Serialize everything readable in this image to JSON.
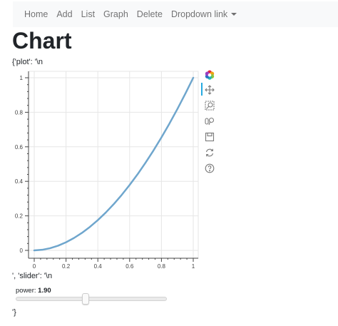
{
  "nav": {
    "items": [
      "Home",
      "Add",
      "List",
      "Graph",
      "Delete"
    ],
    "dropdown_label": "Dropdown link"
  },
  "page": {
    "title": "Chart",
    "prefix_text": "{'plot': '\\n",
    "middle_text": "', 'slider': '\\n",
    "suffix_text": "'}"
  },
  "slider": {
    "label": "power: ",
    "value_text": "1.90",
    "value": 1.9,
    "start": 0.1,
    "end": 4
  },
  "toolbar": {
    "tools": [
      "bokeh-logo-icon",
      "pan-icon",
      "box-zoom-icon",
      "wheel-zoom-icon",
      "save-icon",
      "reset-icon",
      "help-icon"
    ]
  },
  "chart_data": {
    "type": "line",
    "function": "y = x^power",
    "power": 1.9,
    "xlim": [
      0,
      1
    ],
    "ylim": [
      0,
      1
    ],
    "xticks": [
      "0",
      "0.2",
      "0.4",
      "0.6",
      "0.8",
      "1"
    ],
    "yticks": [
      "0",
      "0.2",
      "0.4",
      "0.6",
      "0.8",
      "1"
    ],
    "x": [
      0,
      0.05,
      0.1,
      0.15,
      0.2,
      0.25,
      0.3,
      0.35,
      0.4,
      0.45,
      0.5,
      0.55,
      0.6,
      0.65,
      0.7,
      0.75,
      0.8,
      0.85,
      0.9,
      0.95,
      1
    ],
    "y": [
      0,
      0.0034,
      0.0126,
      0.0272,
      0.047,
      0.0718,
      0.1015,
      0.136,
      0.1753,
      0.2193,
      0.2679,
      0.3212,
      0.3791,
      0.441,
      0.5079,
      0.5789,
      0.6543,
      0.7342,
      0.8185,
      0.9072,
      1
    ],
    "line_color": "#6fa6cd",
    "grid": true
  }
}
